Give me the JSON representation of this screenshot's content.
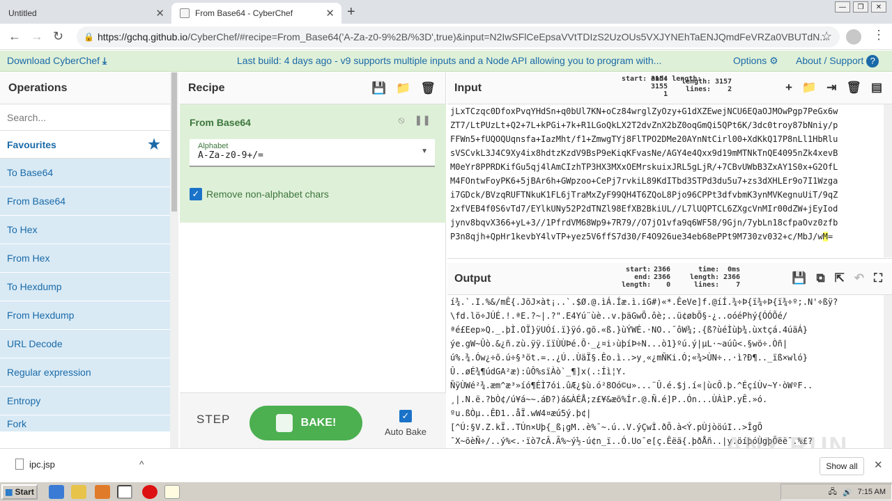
{
  "browser": {
    "tabs": [
      {
        "title": "Untitled"
      },
      {
        "title": "From Base64 - CyberChef"
      }
    ],
    "url_domain": "https://gchq.github.io",
    "url_rest": "/CyberChef/#recipe=From_Base64('A-Za-z0-9%2B/%3D',true)&input=N2IwSFlCeEpsaVVtTDIzS2UzOUs5VXJYNEhTaENJQmdFeVRZa0VBUTdN..."
  },
  "banner": {
    "download": "Download CyberChef",
    "build_prefix": "Last build: 4 days ago - v9 supports multiple inputs and a Node API allowing you to program with...",
    "options": "Options",
    "about": "About / Support"
  },
  "operations": {
    "title": "Operations",
    "search_placeholder": "Search...",
    "favourites": "Favourites",
    "items": [
      "To Base64",
      "From Base64",
      "To Hex",
      "From Hex",
      "To Hexdump",
      "From Hexdump",
      "URL Decode",
      "Regular expression",
      "Entropy",
      "Fork"
    ]
  },
  "recipe": {
    "title": "Recipe",
    "operation": "From Base64",
    "arg_label": "Alphabet",
    "arg_value": "A-Za-z0-9+/=",
    "checkbox_label": "Remove non-alphabet chars",
    "step": "STEP",
    "bake": "BAKE!",
    "autobake": "Auto Bake"
  },
  "input": {
    "title": "Input",
    "stats_labels": "start:\nend:\nlength:",
    "stats_values": "3154\n3155\n1",
    "stats2_labels": "length:\nlines:",
    "stats2_values": "3157\n2",
    "lines": [
      "jLxTCzqc0DfoxPvqYHdSn+q0bUl7KN+oCz84wrglZyOzy+G1dXZEwejNCU6EQaOJMOwPgp7PeGx6w",
      "ZT7/LtPUzLt+Q2+7L+kPGi+7k+R1LGoQkLX2T2dvZnX2bZ0oqGmQi5QPt6K/3dc0troy87bNniy/p",
      "FFWn5+fUQOQUqnsfa+IazMht/f1+ZmwgTYj8FlTPO2DMe20AYnNtCirl00+XdKkQ17P8nLl1HbRlu",
      "sVSCvkL3J4C9Xy4ix8hdtzKzdV9BsP9eKiqKFvasNe/AGY4e4Qxx9d19mMTNkTnQE4095nZk4xevB",
      "M0eYr8PPRDKifGu5qj4lAmCIzhTP3HX3MXxOEMrskuixJRL5gLjR/+7CBvUWbB3ZxAY1S0x+G2OfL",
      "M4FOntwFoyPK6+5jBAr6h+GWpzoo+CePj7rvkiL89KdITbd3STPd3du5u7+zs3dXHLEr9o7I1Wzga",
      "i7GDck/BVzqRUFTNkuK1FL6jTraMxZyF99QH4T6ZQoL8Pjo96CPPt3dfvbmK3ynMVKegnuUiT/9qZ",
      "2xfVEB4f0S6vTd7/EYlkUNy52P2dTNZl98EfXB2BkiUL//L7lUQPTCL6ZXgcVnMIr00dZW+jEyIod",
      "jynv8bqvX366+yL+3//1PfrdVM68Wp9+7R79//O7jO1vfa9q6WF58/9Gjn/7ybLn18cfpaOvz0zfb",
      "P3n8qjh+QpHr1kevbY4lvTP+yez5V6ffS7d30/F4O926ue34eb68ePPt9M730zv032+c/MbJ/w",
      "M",
      "="
    ]
  },
  "output": {
    "title": "Output",
    "stats_labels": "start:\nend:\nlength:",
    "stats_values": "2366\n2366\n0",
    "stats2_labels": "time:\nlength:\nlines:",
    "stats2_values": "0ms\n2366\n7",
    "lines": [
      "í¾.`.I.%&/mÊ{.JõJ×àt¡..`.$Ø.@.ìÁ.Íæ.ì.iG#)«*.ÊeVe]f.@íÍ.¾÷Þ{ï¾÷Þ{ï¾÷º;.N'÷ßÿ?",
      "\\fd.lö÷JÚÉ.!.ªE.?~|.?\".E4Yú¨ùè..v.þäGwÕ.ôè;..ü¢øbÕ§-¿..oóéPhý{ÓÓÕé/",
      "ªé£Eep»Q._.þÌ.OÏ}ÿUÓí.ï}ÿó.gõ.«ß.}ùÝWÉ.·NO..¯ôW¾;.{ß?ùéÌùþ¾.ùxtçá.4úäÁ}",
      "ýe.gW~Ûò.&¿ñ.zù.ÿÿ.ïïÙÙÞé.Õ·_¿¤i›ùþíÞ÷N...ò1}ºú.ý|µL·~aúû<.§wö÷.Òñ|",
      "ú%.¾.Ów¿÷õ.ú÷§³öt.=..¿Ú..ÙäÏ§.Êo.ì..>y¸«¿mÑKi.Ó;«¾>ÙN÷..·ì?Ð¶.._ïß×wló}",
      "Û..øÉ¾¶údGA²æ):ûÔ%sïÀò`_¶]x(.:Íì¦Y.",
      "ÑÿÙWé²¾.æm^æ³»íó¶ÉÌ7ói.ûÆ¿$ù.ó²8Oó©u»...¨Û.é.$j.í«|ùcÔ.þ.^ÉçíÙv~Y·òWºF..",
      "¸|.N.ë.?bÒ¢/ú¥á~~.áÐ?)á&ÀÉÅ;z£¥&æõ%Ír.@.Ñ.é]P..Ón...ÙÀìP.yÊ.»ó.",
      "ºu.ßÒµ..ÊÐ1..åÏ.wW4¤æú5ý.þ¢|",
      "[^Ú:§V.Z.kÏ..TÚn×Uþ{_ß¡gM..è%¯~.ú..V.ýÇwÌ.ðÕ.à<Ý.pÙjòöúI..>ÎgÕ",
      "¯X~õèÑ÷/..ý%<.·ïò7cÂ.Ã%~ý½-ú¢n_ï..Ó.Uo¯e[ç.Êëä{.þðÅñ..|y.öíþóÙgþÕëë¯.%£?"
    ]
  },
  "downloads": {
    "file": "ipc.jsp",
    "show_all": "Show all"
  },
  "taskbar": {
    "start": "Start",
    "time": "7:15 AM"
  },
  "watermark": "ANY RUN"
}
